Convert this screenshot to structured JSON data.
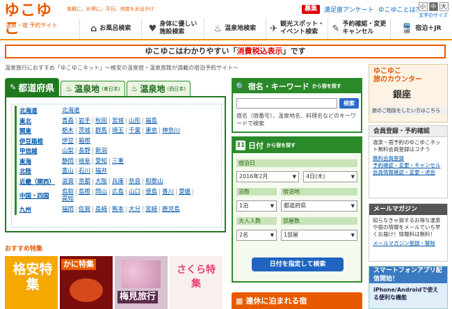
{
  "header": {
    "logo_main": "ゆこゆこ",
    "logo_sub": "温泉・宿 予約サイト",
    "tagline": "気軽に、お得に。平日、何度もお出かけ",
    "badge": "募集",
    "survey_link": "満足度アンケート",
    "about_link": "ゆこゆことは？",
    "font_sizes": [
      "小",
      "中",
      "大"
    ],
    "font_label": "文字のサイズ"
  },
  "nav": [
    {
      "icon": "⌂",
      "label": "お風呂検索"
    },
    {
      "icon": "♥",
      "label": "身体に優しい\n施設検索"
    },
    {
      "icon": "♨",
      "label": "温泉地検索"
    },
    {
      "icon": "✈",
      "label": "観光スポット・\nイベント検索"
    },
    {
      "icon": "✎",
      "label": "予約確認・変更\nキャンセル"
    },
    {
      "icon": "🚆",
      "label": "宿泊＋JR"
    }
  ],
  "banner": {
    "pre": "ゆこゆこはわかりやすい「",
    "highlight": "消費税込表示",
    "post": "」です"
  },
  "crumb": "温泉旅行におすすめ「ゆこゆこネット」〜格安の温泉宿・温泉旅館が満載の宿泊予約サイト〜",
  "region_tabs": [
    {
      "label": "都道府県",
      "sub": ""
    },
    {
      "label": "温泉地",
      "sub": "(東日本)"
    },
    {
      "label": "温泉地",
      "sub": "(西日本)"
    }
  ],
  "regions": [
    {
      "name": "北海道",
      "prefs": [
        "北海道"
      ]
    },
    {
      "name": "東北",
      "prefs": [
        "青森",
        "岩手",
        "秋田",
        "宮城",
        "山形",
        "福島"
      ]
    },
    {
      "name": "関東",
      "prefs": [
        "栃木",
        "茨城",
        "群馬",
        "埼玉",
        "千葉",
        "東京",
        "神奈川"
      ]
    },
    {
      "name": "伊豆箱根",
      "prefs": [
        "伊豆",
        "箱根"
      ]
    },
    {
      "name": "甲信越",
      "prefs": [
        "山梨",
        "長野",
        "新潟"
      ]
    },
    {
      "name": "東海",
      "prefs": [
        "静岡",
        "岐阜",
        "愛知",
        "三重"
      ]
    },
    {
      "name": "北陸",
      "prefs": [
        "富山",
        "石川",
        "福井"
      ]
    },
    {
      "name": "近畿（関西）",
      "prefs": [
        "滋賀",
        "京都",
        "大阪",
        "兵庫",
        "奈良",
        "和歌山"
      ]
    },
    {
      "name": "中国・四国",
      "prefs": [
        "鳥取",
        "島根",
        "岡山",
        "広島",
        "山口",
        "徳島",
        "香川",
        "愛媛",
        "高知"
      ]
    },
    {
      "name": "九州",
      "prefs": [
        "福岡",
        "佐賀",
        "長崎",
        "熊本",
        "大分",
        "宮崎",
        "鹿児島"
      ]
    }
  ],
  "reco": {
    "title": "おすすめ特集",
    "items": [
      "格安特集",
      "かに特集",
      "梅見旅行",
      "さくら特集"
    ]
  },
  "keyword": {
    "title": "宿名・キーワード",
    "title_sub": "から宿を探す",
    "placeholder": "",
    "button": "検索",
    "desc": "宿名（宿番号）、温泉地名、料理名などのキーワードで検索"
  },
  "date_search": {
    "title": "日付",
    "title_sub": "から宿を探す",
    "checkin_label": "宿泊日",
    "month": "2016年2月",
    "day": "4日(木)",
    "nights_label": "泊数",
    "area_label": "宿泊地",
    "nights": "1泊",
    "area": "都道府県",
    "adults_label": "大人人数",
    "rooms_label": "部屋数",
    "adults": "2名",
    "rooms": "1部屋",
    "button": "日付を指定して検索"
  },
  "holiday": "連休に泊まれる宿",
  "counter": {
    "line1": "ゆこゆこ",
    "line2": "旅のカウンター",
    "name": "銀座",
    "foot": "旅のご相談をしたい方はこちら"
  },
  "member": {
    "title": "会員登録・予約確認",
    "desc": "温泉・宿予約のゆこゆこネット無料会員登録はコチラ",
    "links": [
      "無料会員登録",
      "予約確認・変更・キャンセル",
      "会員情報確認・変更・退会"
    ]
  },
  "magazine": {
    "title": "メールマガジン",
    "desc": "知らなきゃ損するお得な温泉や宿の情報をメールでいち早くお届け！情報料は無料！",
    "link": "メールマガジン登録・解除"
  },
  "smartphone": {
    "title": "スマートフォンアプリ配信開始！",
    "desc": "iPhone/Androidで使える便利な機能"
  }
}
